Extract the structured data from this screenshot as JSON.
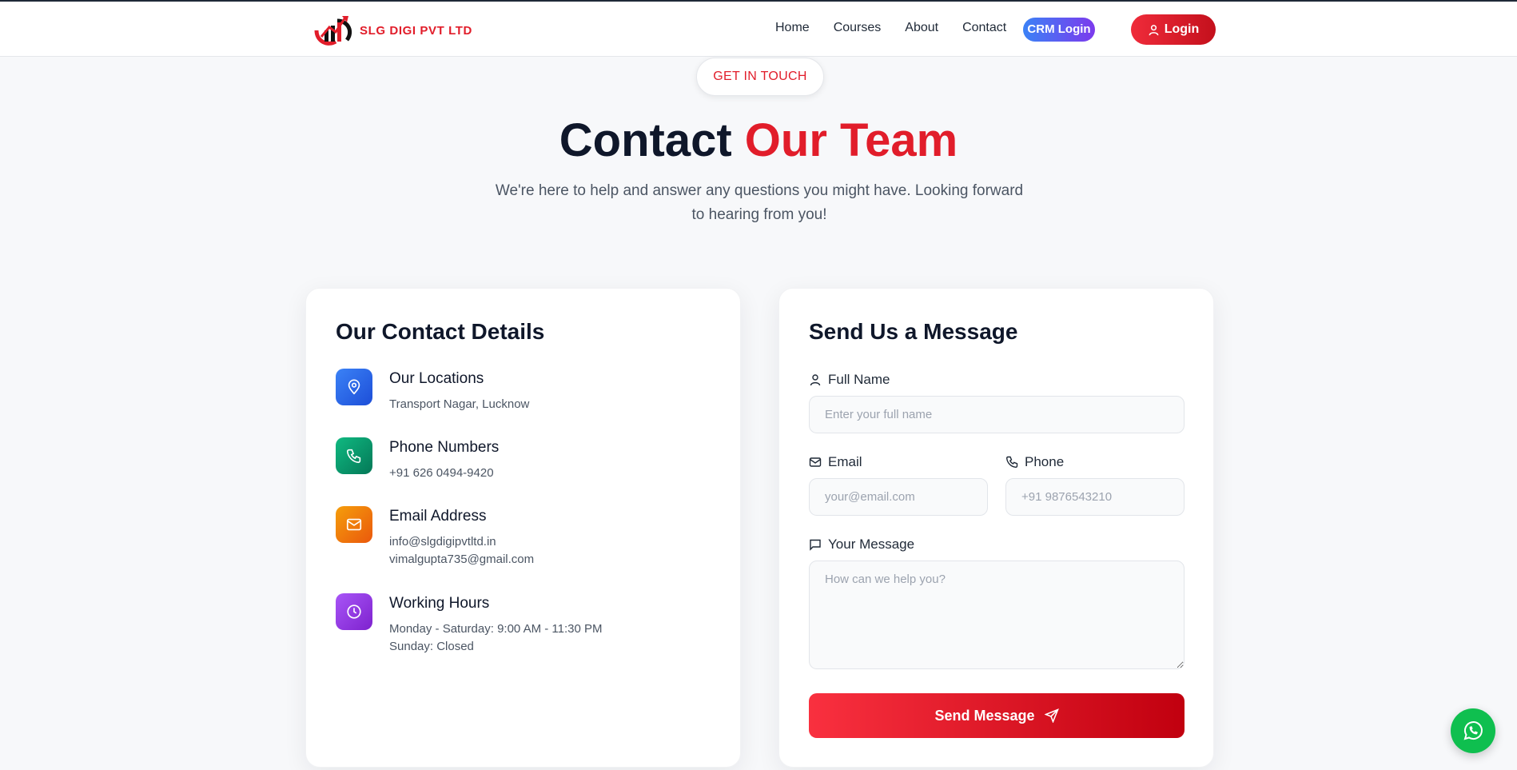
{
  "brand": {
    "name": "SLG DIGI PVT LTD"
  },
  "nav": {
    "items": [
      {
        "label": "Home"
      },
      {
        "label": "Courses"
      },
      {
        "label": "About"
      },
      {
        "label": "Contact"
      }
    ],
    "crm_label": "CRM Login",
    "login_label": "Login"
  },
  "hero": {
    "pill": "GET IN TOUCH",
    "title_main": "Contact",
    "title_accent": "Our Team",
    "subtitle": "We're here to help and answer any questions you might have. Looking forward to hearing from you!"
  },
  "details": {
    "title": "Our Contact Details",
    "items": [
      {
        "icon": "map-pin-icon",
        "color": "#2563eb",
        "title": "Our Locations",
        "lines": [
          "Transport Nagar, Lucknow"
        ]
      },
      {
        "icon": "phone-icon",
        "color": "#059669",
        "title": "Phone Numbers",
        "lines": [
          "+91 626 0494-9420"
        ]
      },
      {
        "icon": "mail-icon",
        "color": "#f59e0b",
        "title": "Email Address",
        "lines": [
          "info@slgdigipvtltd.in",
          "vimalgupta735@gmail.com"
        ]
      },
      {
        "icon": "clock-icon",
        "color": "#9333ea",
        "title": "Working Hours",
        "lines": [
          "Monday - Saturday: 9:00 AM - 11:30 PM",
          "Sunday: Closed"
        ]
      }
    ]
  },
  "form": {
    "title": "Send Us a Message",
    "name_label": "Full Name",
    "name_placeholder": "Enter your full name",
    "email_label": "Email",
    "email_placeholder": "your@email.com",
    "phone_label": "Phone",
    "phone_placeholder": "+91 9876543210",
    "message_label": "Your Message",
    "message_placeholder": "How can we help you?",
    "submit_label": "Send Message"
  },
  "colors": {
    "accent": "#e11d2a",
    "whatsapp": "#0fbf4f"
  }
}
